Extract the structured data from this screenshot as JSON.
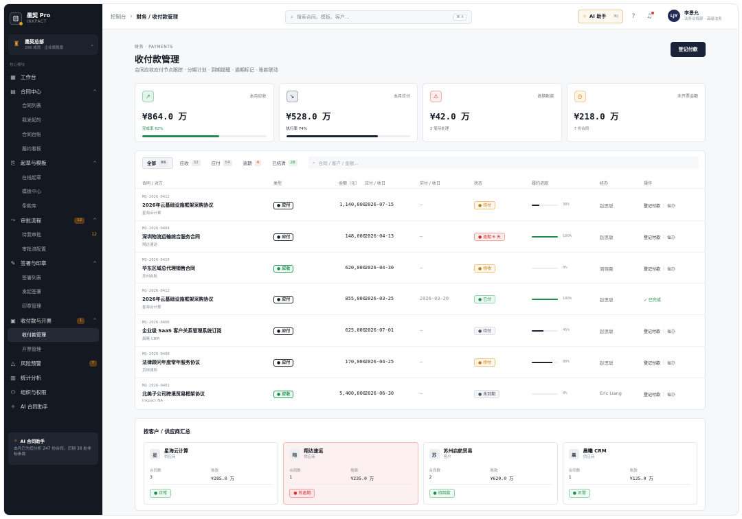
{
  "brand": {
    "name": "墨契 Pro",
    "sub": "INKPACT"
  },
  "org": {
    "name": "墨契总部",
    "meta": "286 成员 · 企业旗舰版"
  },
  "section_label": "核心模块",
  "nav": [
    {
      "kind": "item",
      "label": "工作台",
      "icon": "grid-icon",
      "glyph": "▦"
    },
    {
      "kind": "item",
      "label": "合同中心",
      "icon": "document-icon",
      "glyph": "▤",
      "chev": "^"
    },
    {
      "kind": "sub",
      "label": "合同列表"
    },
    {
      "kind": "sub",
      "label": "我发起的"
    },
    {
      "kind": "sub",
      "label": "合同台账"
    },
    {
      "kind": "sub",
      "label": "履约看板"
    },
    {
      "kind": "item",
      "label": "起草与模板",
      "icon": "template-icon",
      "glyph": "⎘",
      "chev": "^"
    },
    {
      "kind": "sub",
      "label": "在线起草"
    },
    {
      "kind": "sub",
      "label": "模板中心"
    },
    {
      "kind": "sub",
      "label": "条款库"
    },
    {
      "kind": "item",
      "label": "审批流程",
      "icon": "flow-icon",
      "glyph": "⤳",
      "badge": "12",
      "chev": "^"
    },
    {
      "kind": "sub",
      "label": "待我审批",
      "count": "12"
    },
    {
      "kind": "sub",
      "label": "审批流配置"
    },
    {
      "kind": "item",
      "label": "签署与印章",
      "icon": "pen-icon",
      "glyph": "✎",
      "chev": "^"
    },
    {
      "kind": "sub",
      "label": "签署列表"
    },
    {
      "kind": "sub",
      "label": "发起签署"
    },
    {
      "kind": "sub",
      "label": "印章管理"
    },
    {
      "kind": "item",
      "label": "收付款与开票",
      "icon": "wallet-icon",
      "glyph": "▣",
      "badge": "1",
      "chev": "^"
    },
    {
      "kind": "sub",
      "label": "收付款管理",
      "active": true
    },
    {
      "kind": "sub",
      "label": "开票管理"
    },
    {
      "kind": "item",
      "label": "风险预警",
      "icon": "warning-icon",
      "glyph": "△",
      "badge": "7"
    },
    {
      "kind": "item",
      "label": "统计分析",
      "icon": "chart-icon",
      "glyph": "▥"
    },
    {
      "kind": "item",
      "label": "组织与权限",
      "icon": "users-icon",
      "glyph": "⚇"
    },
    {
      "kind": "item",
      "label": "AI 合同助手",
      "icon": "sparkle-icon",
      "glyph": "✧"
    }
  ],
  "ai_card": {
    "title": "AI 合同助手",
    "text": "本月已为您分析 247 份合同，识别 38 处非标条款"
  },
  "topbar": {
    "crumb_root": "控制台",
    "crumb_sep": "›",
    "crumb_current": "财务 / 收付款管理",
    "search_placeholder": "搜索合同、模板、客户...",
    "search_kbd": "⌘ K",
    "ai_label": "AI 助手",
    "ai_kbd": "⌘J",
    "user_initials": "LJY",
    "user_name": "李景允",
    "user_role": "法务合规部 · 高级法务"
  },
  "page": {
    "eyebrow": "财务 · PAYMENTS",
    "title": "收付款管理",
    "subtitle": "合同应收应付节点跟踪 · 分期计划 · 到期提醒 · 逾期标记 · 账款联动",
    "primary_button": "登记付款"
  },
  "kpis": [
    {
      "label": "本月应收",
      "value": "¥864.0 万",
      "note": "完成率 62%",
      "progress": 0.62,
      "icon": "trend-up-icon",
      "glyph": "↗",
      "color": "#1e8c4e",
      "bg": "#e6f5ec"
    },
    {
      "label": "本月应付",
      "value": "¥528.0 万",
      "note": "执行率 74%",
      "progress": 0.74,
      "icon": "trend-down-icon",
      "glyph": "↘",
      "color": "#1a2238",
      "bg": "#eceef4"
    },
    {
      "label": "逾期账款",
      "value": "¥42.0 万",
      "note": "2 笔待处理",
      "icon": "alert-icon",
      "glyph": "⚠",
      "color": "#cf3030",
      "bg": "#fdeeee"
    },
    {
      "label": "未开票金额",
      "value": "¥218.0 万",
      "note": "7 份合同",
      "icon": "clock-icon",
      "glyph": "◷",
      "color": "#d77a14",
      "bg": "#fff3e3"
    }
  ],
  "filters": [
    {
      "label": "全部",
      "count": "86",
      "active": true,
      "tone": ""
    },
    {
      "label": "应收",
      "count": "32",
      "tone": ""
    },
    {
      "label": "应付",
      "count": "54",
      "tone": ""
    },
    {
      "label": "逾期",
      "count": "4",
      "tone": "red"
    },
    {
      "label": "已结清",
      "count": "28",
      "tone": "green"
    }
  ],
  "table_search_placeholder": "合同 / 客户 / 金额...",
  "columns": {
    "contract": "合同 / 对方",
    "type": "类型",
    "amount": "金额（元）",
    "due": "应付 / 收日",
    "paid": "实付 / 收日",
    "status": "状态",
    "progress": "履约进度",
    "owner": "经办",
    "ops": "操作"
  },
  "rows": [
    {
      "id": "MQ-2026-0412",
      "name": "2026年云基础设施框架采购协议",
      "party": "星海云计算",
      "type": "● 应付",
      "type_kind": "pay",
      "amount": "1,140,000",
      "due": "2026-07-15",
      "paid": "—",
      "status": "● 待付",
      "status_kind": "pending",
      "progress": 0.3,
      "pct": "30%",
      "bar": "#1a2238",
      "owner": "赵思聪",
      "op1": "登记付款",
      "op2": "催办"
    },
    {
      "id": "MQ-2026-0404",
      "name": "深圳物流运输综合服务合同",
      "party": "翔达速运",
      "type": "● 应付",
      "type_kind": "pay",
      "amount": "148,000",
      "due": "2026-04-13",
      "paid": "—",
      "status": "● 逾期 6 天",
      "status_kind": "overdue",
      "progress": 1.0,
      "pct": "100%",
      "bar": "#1e8c4e",
      "owner": "赵思聪",
      "op1": "登记付款",
      "op2": "催办"
    },
    {
      "id": "MQ-2026-0410",
      "name": "华东区域总代理销售合同",
      "party": "苏州启航",
      "type": "● 应收",
      "type_kind": "recv",
      "amount": "620,000",
      "due": "2026-04-30",
      "paid": "—",
      "status": "● 待收",
      "status_kind": "recv",
      "progress": 0.0,
      "pct": "0%",
      "bar": "#1a2238",
      "owner": "周晓薇",
      "op1": "登记付款",
      "op2": "催办"
    },
    {
      "id": "MQ-2026-0412",
      "name": "2026年云基础设施框架采购协议",
      "party": "星海云计算",
      "type": "● 应付",
      "type_kind": "pay",
      "amount": "855,000",
      "due": "2026-03-25",
      "paid": "2026-03-20",
      "status": "● 已付",
      "status_kind": "paid",
      "progress": 1.0,
      "pct": "100%",
      "bar": "#1e8c4e",
      "owner": "赵思聪",
      "done": "✓ 已完成"
    },
    {
      "id": "MQ-2026-0406",
      "name": "企业级 SaaS 客户关系管理系统订阅",
      "party": "晨曦 CRM",
      "type": "● 应付",
      "type_kind": "pay",
      "amount": "625,000",
      "due": "2026-07-01",
      "paid": "—",
      "status": "● 待付",
      "status_kind": "wait",
      "progress": 0.45,
      "pct": "45%",
      "bar": "#1a2238",
      "owner": "赵思聪",
      "op1": "登记付款",
      "op2": "催办"
    },
    {
      "id": "MQ-2026-0408",
      "name": "法律顾问年度常年服务协议",
      "party": "京恒律所",
      "type": "● 应付",
      "type_kind": "pay",
      "amount": "170,000",
      "due": "2026-04-25",
      "paid": "—",
      "status": "● 待付",
      "status_kind": "pending",
      "progress": 0.8,
      "pct": "80%",
      "bar": "#1a2238",
      "owner": "赵思聪",
      "op1": "登记付款",
      "op2": "催办"
    },
    {
      "id": "MQ-2026-0401",
      "name": "北美子公司跨境贸易框架协议",
      "party": "Inkpact NA",
      "type": "● 应收",
      "type_kind": "recv",
      "amount": "5,400,000",
      "due": "2026-06-30",
      "paid": "—",
      "status": "● 未到期",
      "status_kind": "notdue",
      "progress": 0.0,
      "pct": "0%",
      "bar": "#1a2238",
      "owner": "Eric Liang",
      "op1": "登记付款",
      "op2": "催办"
    }
  ],
  "summary": {
    "title": "按客户 / 供应商汇总",
    "count_label": "合同数",
    "amount_label": "账款",
    "cards": [
      {
        "avatar": "星",
        "name": "星海云计算",
        "role": "供应商",
        "count": "3",
        "amount": "¥285.0 万",
        "tag": "● 正常",
        "tag_kind": "ok",
        "alert": false
      },
      {
        "avatar": "翔",
        "name": "翔达速运",
        "role": "供应商",
        "count": "1",
        "amount": "¥235.0 万",
        "tag": "● 有逾期",
        "tag_kind": "bad",
        "alert": true
      },
      {
        "avatar": "苏",
        "name": "苏州启航贸易",
        "role": "客户",
        "count": "2",
        "amount": "¥620.0 万",
        "tag": "● 待回款",
        "tag_kind": "ok",
        "alert": false
      },
      {
        "avatar": "晨",
        "name": "晨曦 CRM",
        "role": "供应商",
        "count": "1",
        "amount": "¥125.0 万",
        "tag": "● 正常",
        "tag_kind": "ok",
        "alert": false
      }
    ]
  }
}
